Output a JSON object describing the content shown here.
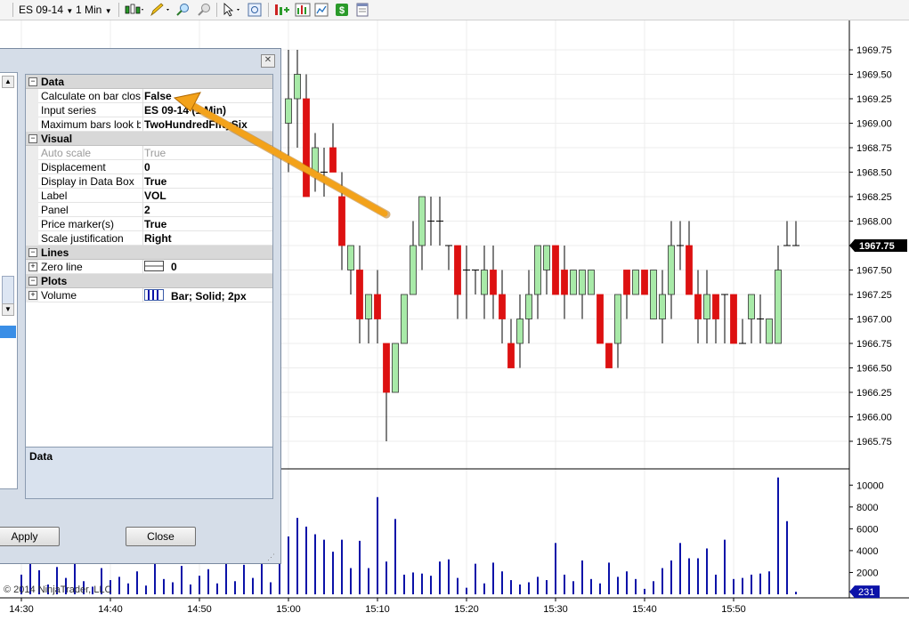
{
  "toolbar": {
    "instrument": "ES 09-14",
    "interval": "1 Min"
  },
  "dialog": {
    "categories": [
      {
        "name": "Data",
        "properties": [
          {
            "name": "Calculate on bar close",
            "value": "False"
          },
          {
            "name": "Input series",
            "value": "ES 09-14 (1 Min)"
          },
          {
            "name": "Maximum bars look back",
            "value": "TwoHundredFiftySix"
          }
        ]
      },
      {
        "name": "Visual",
        "properties": [
          {
            "name": "Auto scale",
            "value": "True"
          },
          {
            "name": "Displacement",
            "value": "0"
          },
          {
            "name": "Display in Data Box",
            "value": "True"
          },
          {
            "name": "Label",
            "value": "VOL"
          },
          {
            "name": "Panel",
            "value": "2"
          },
          {
            "name": "Price marker(s)",
            "value": "True"
          },
          {
            "name": "Scale justification",
            "value": "Right"
          }
        ]
      },
      {
        "name": "Lines",
        "properties": [
          {
            "name": "Zero line",
            "value": "0"
          }
        ]
      },
      {
        "name": "Plots",
        "properties": [
          {
            "name": "Volume",
            "value": "Bar; Solid; 2px"
          }
        ]
      }
    ],
    "description_title": "Data",
    "apply_label": "Apply",
    "close_label": "Close"
  },
  "copyright": "© 2014 NinjaTrader, LLC",
  "chart_data": {
    "type": "candlestick",
    "instrument": "ES 09-14",
    "interval": "1 Min",
    "price_axis_ticks": [
      "1969.75",
      "1969.50",
      "1969.25",
      "1969.00",
      "1968.75",
      "1968.50",
      "1968.25",
      "1968.00",
      "1967.75",
      "1967.50",
      "1967.25",
      "1967.00",
      "1966.75",
      "1966.50",
      "1966.25",
      "1966.00",
      "1965.75"
    ],
    "price_ylim": [
      1965.5,
      1970.0
    ],
    "last_price": "1967.75",
    "time_ticks": [
      "14:30",
      "14:40",
      "14:50",
      "15:00",
      "15:10",
      "15:20",
      "15:30",
      "15:40",
      "15:50"
    ],
    "volume_axis_ticks": [
      "10000",
      "8000",
      "6000",
      "4000",
      "2000"
    ],
    "volume_ylim": [
      0,
      11000
    ],
    "last_volume": "231",
    "candles": [
      {
        "t": "15:00",
        "o": 1969.0,
        "h": 1969.75,
        "l": 1968.5,
        "c": 1969.25
      },
      {
        "t": "15:01",
        "o": 1969.25,
        "h": 1969.75,
        "l": 1968.75,
        "c": 1969.5
      },
      {
        "t": "15:02",
        "o": 1969.25,
        "h": 1969.5,
        "l": 1968.25,
        "c": 1968.25
      },
      {
        "t": "15:03",
        "o": 1968.5,
        "h": 1968.9,
        "l": 1968.3,
        "c": 1968.75
      },
      {
        "t": "15:04",
        "o": 1968.5,
        "h": 1968.75,
        "l": 1968.25,
        "c": 1968.5
      },
      {
        "t": "15:05",
        "o": 1968.75,
        "h": 1969.0,
        "l": 1968.5,
        "c": 1968.5
      },
      {
        "t": "15:06",
        "o": 1968.25,
        "h": 1968.5,
        "l": 1967.5,
        "c": 1967.75
      },
      {
        "t": "15:07",
        "o": 1967.5,
        "h": 1967.75,
        "l": 1967.25,
        "c": 1967.75
      },
      {
        "t": "15:08",
        "o": 1967.5,
        "h": 1967.75,
        "l": 1966.75,
        "c": 1967.0
      },
      {
        "t": "15:09",
        "o": 1967.0,
        "h": 1967.25,
        "l": 1966.75,
        "c": 1967.25
      },
      {
        "t": "15:10",
        "o": 1967.25,
        "h": 1967.5,
        "l": 1966.75,
        "c": 1967.0
      },
      {
        "t": "15:11",
        "o": 1966.75,
        "h": 1966.75,
        "l": 1965.75,
        "c": 1966.25
      },
      {
        "t": "15:12",
        "o": 1966.25,
        "h": 1966.75,
        "l": 1966.25,
        "c": 1966.75
      },
      {
        "t": "15:13",
        "o": 1966.75,
        "h": 1967.25,
        "l": 1966.75,
        "c": 1967.25
      },
      {
        "t": "15:14",
        "o": 1967.25,
        "h": 1968.0,
        "l": 1967.25,
        "c": 1967.75
      },
      {
        "t": "15:15",
        "o": 1967.75,
        "h": 1968.25,
        "l": 1967.5,
        "c": 1968.25
      },
      {
        "t": "15:16",
        "o": 1968.0,
        "h": 1968.25,
        "l": 1967.75,
        "c": 1968.0
      },
      {
        "t": "15:17",
        "o": 1968.0,
        "h": 1968.25,
        "l": 1967.75,
        "c": 1968.0
      },
      {
        "t": "15:18",
        "o": 1967.75,
        "h": 1967.75,
        "l": 1967.5,
        "c": 1967.75
      },
      {
        "t": "15:19",
        "o": 1967.75,
        "h": 1967.75,
        "l": 1967.0,
        "c": 1967.25
      },
      {
        "t": "15:20",
        "o": 1967.5,
        "h": 1967.75,
        "l": 1967.0,
        "c": 1967.5
      },
      {
        "t": "15:21",
        "o": 1967.5,
        "h": 1967.5,
        "l": 1967.25,
        "c": 1967.5
      },
      {
        "t": "15:22",
        "o": 1967.25,
        "h": 1967.75,
        "l": 1967.0,
        "c": 1967.5
      },
      {
        "t": "15:23",
        "o": 1967.5,
        "h": 1967.75,
        "l": 1967.0,
        "c": 1967.25
      },
      {
        "t": "15:24",
        "o": 1967.25,
        "h": 1967.5,
        "l": 1966.75,
        "c": 1967.0
      },
      {
        "t": "15:25",
        "o": 1966.75,
        "h": 1967.0,
        "l": 1966.5,
        "c": 1966.5
      },
      {
        "t": "15:26",
        "o": 1966.75,
        "h": 1967.25,
        "l": 1966.5,
        "c": 1967.0
      },
      {
        "t": "15:27",
        "o": 1967.0,
        "h": 1967.5,
        "l": 1966.75,
        "c": 1967.25
      },
      {
        "t": "15:28",
        "o": 1967.25,
        "h": 1967.75,
        "l": 1967.0,
        "c": 1967.75
      },
      {
        "t": "15:29",
        "o": 1967.5,
        "h": 1967.75,
        "l": 1967.25,
        "c": 1967.75
      },
      {
        "t": "15:30",
        "o": 1967.75,
        "h": 1967.75,
        "l": 1967.25,
        "c": 1967.25
      },
      {
        "t": "15:31",
        "o": 1967.5,
        "h": 1967.75,
        "l": 1967.0,
        "c": 1967.25
      },
      {
        "t": "15:32",
        "o": 1967.25,
        "h": 1967.5,
        "l": 1967.25,
        "c": 1967.5
      },
      {
        "t": "15:33",
        "o": 1967.25,
        "h": 1967.5,
        "l": 1967.0,
        "c": 1967.5
      },
      {
        "t": "15:34",
        "o": 1967.25,
        "h": 1967.5,
        "l": 1967.25,
        "c": 1967.5
      },
      {
        "t": "15:35",
        "o": 1967.25,
        "h": 1967.25,
        "l": 1966.75,
        "c": 1966.75
      },
      {
        "t": "15:36",
        "o": 1966.75,
        "h": 1966.75,
        "l": 1966.5,
        "c": 1966.5
      },
      {
        "t": "15:37",
        "o": 1966.75,
        "h": 1967.25,
        "l": 1966.5,
        "c": 1967.25
      },
      {
        "t": "15:38",
        "o": 1967.5,
        "h": 1967.5,
        "l": 1967.0,
        "c": 1967.25
      },
      {
        "t": "15:39",
        "o": 1967.25,
        "h": 1967.5,
        "l": 1967.25,
        "c": 1967.5
      },
      {
        "t": "15:40",
        "o": 1967.5,
        "h": 1967.5,
        "l": 1967.25,
        "c": 1967.25
      },
      {
        "t": "15:41",
        "o": 1967.0,
        "h": 1967.5,
        "l": 1967.0,
        "c": 1967.5
      },
      {
        "t": "15:42",
        "o": 1967.0,
        "h": 1967.5,
        "l": 1966.75,
        "c": 1967.25
      },
      {
        "t": "15:43",
        "o": 1967.25,
        "h": 1968.0,
        "l": 1967.0,
        "c": 1967.75
      },
      {
        "t": "15:44",
        "o": 1967.75,
        "h": 1968.0,
        "l": 1967.5,
        "c": 1967.75
      },
      {
        "t": "15:45",
        "o": 1967.75,
        "h": 1968.0,
        "l": 1967.25,
        "c": 1967.25
      },
      {
        "t": "15:46",
        "o": 1967.25,
        "h": 1967.5,
        "l": 1966.75,
        "c": 1967.0
      },
      {
        "t": "15:47",
        "o": 1967.0,
        "h": 1967.5,
        "l": 1966.75,
        "c": 1967.25
      },
      {
        "t": "15:48",
        "o": 1967.25,
        "h": 1967.25,
        "l": 1966.75,
        "c": 1967.0
      },
      {
        "t": "15:49",
        "o": 1967.25,
        "h": 1967.25,
        "l": 1966.75,
        "c": 1967.25
      },
      {
        "t": "15:50",
        "o": 1967.25,
        "h": 1967.25,
        "l": 1966.75,
        "c": 1966.75
      },
      {
        "t": "15:51",
        "o": 1966.75,
        "h": 1967.0,
        "l": 1966.75,
        "c": 1966.75
      },
      {
        "t": "15:52",
        "o": 1967.0,
        "h": 1967.25,
        "l": 1966.75,
        "c": 1967.25
      },
      {
        "t": "15:53",
        "o": 1967.0,
        "h": 1967.25,
        "l": 1966.75,
        "c": 1967.0
      },
      {
        "t": "15:54",
        "o": 1966.75,
        "h": 1967.0,
        "l": 1966.75,
        "c": 1967.0
      },
      {
        "t": "15:55",
        "o": 1966.75,
        "h": 1967.75,
        "l": 1966.75,
        "c": 1967.5
      },
      {
        "t": "15:56",
        "o": 1967.75,
        "h": 1968.0,
        "l": 1967.75,
        "c": 1967.75
      },
      {
        "t": "15:57",
        "o": 1967.75,
        "h": 1968.0,
        "l": 1967.75,
        "c": 1967.75
      }
    ],
    "volume": [
      {
        "t": "14:30",
        "v": 1800
      },
      {
        "t": "14:31",
        "v": 3200
      },
      {
        "t": "14:32",
        "v": 2200
      },
      {
        "t": "14:33",
        "v": 900
      },
      {
        "t": "14:34",
        "v": 2500
      },
      {
        "t": "14:35",
        "v": 1500
      },
      {
        "t": "14:36",
        "v": 2800
      },
      {
        "t": "14:37",
        "v": 1200
      },
      {
        "t": "14:38",
        "v": 700
      },
      {
        "t": "14:39",
        "v": 2400
      },
      {
        "t": "14:40",
        "v": 1300
      },
      {
        "t": "14:41",
        "v": 1600
      },
      {
        "t": "14:42",
        "v": 1000
      },
      {
        "t": "14:43",
        "v": 2100
      },
      {
        "t": "14:44",
        "v": 800
      },
      {
        "t": "14:45",
        "v": 3600
      },
      {
        "t": "14:46",
        "v": 1400
      },
      {
        "t": "14:47",
        "v": 1100
      },
      {
        "t": "14:48",
        "v": 2600
      },
      {
        "t": "14:49",
        "v": 900
      },
      {
        "t": "14:50",
        "v": 1700
      },
      {
        "t": "14:51",
        "v": 2300
      },
      {
        "t": "14:52",
        "v": 1000
      },
      {
        "t": "14:53",
        "v": 3100
      },
      {
        "t": "14:54",
        "v": 1200
      },
      {
        "t": "14:55",
        "v": 2700
      },
      {
        "t": "14:56",
        "v": 1500
      },
      {
        "t": "14:57",
        "v": 3300
      },
      {
        "t": "14:58",
        "v": 1100
      },
      {
        "t": "14:59",
        "v": 4000
      },
      {
        "t": "15:00",
        "v": 5300
      },
      {
        "t": "15:01",
        "v": 7000
      },
      {
        "t": "15:02",
        "v": 6200
      },
      {
        "t": "15:03",
        "v": 5500
      },
      {
        "t": "15:04",
        "v": 5000
      },
      {
        "t": "15:05",
        "v": 3900
      },
      {
        "t": "15:06",
        "v": 5000
      },
      {
        "t": "15:07",
        "v": 2400
      },
      {
        "t": "15:08",
        "v": 4900
      },
      {
        "t": "15:09",
        "v": 2400
      },
      {
        "t": "15:10",
        "v": 8900
      },
      {
        "t": "15:11",
        "v": 3000
      },
      {
        "t": "15:12",
        "v": 6900
      },
      {
        "t": "15:13",
        "v": 1800
      },
      {
        "t": "15:14",
        "v": 2000
      },
      {
        "t": "15:15",
        "v": 1900
      },
      {
        "t": "15:16",
        "v": 1700
      },
      {
        "t": "15:17",
        "v": 3000
      },
      {
        "t": "15:18",
        "v": 3200
      },
      {
        "t": "15:19",
        "v": 1500
      },
      {
        "t": "15:20",
        "v": 600
      },
      {
        "t": "15:21",
        "v": 2800
      },
      {
        "t": "15:22",
        "v": 1000
      },
      {
        "t": "15:23",
        "v": 2900
      },
      {
        "t": "15:24",
        "v": 2100
      },
      {
        "t": "15:25",
        "v": 1300
      },
      {
        "t": "15:26",
        "v": 900
      },
      {
        "t": "15:27",
        "v": 1100
      },
      {
        "t": "15:28",
        "v": 1600
      },
      {
        "t": "15:29",
        "v": 1300
      },
      {
        "t": "15:30",
        "v": 4700
      },
      {
        "t": "15:31",
        "v": 1800
      },
      {
        "t": "15:32",
        "v": 1200
      },
      {
        "t": "15:33",
        "v": 3100
      },
      {
        "t": "15:34",
        "v": 1400
      },
      {
        "t": "15:35",
        "v": 1000
      },
      {
        "t": "15:36",
        "v": 2900
      },
      {
        "t": "15:37",
        "v": 1600
      },
      {
        "t": "15:38",
        "v": 2100
      },
      {
        "t": "15:39",
        "v": 1400
      },
      {
        "t": "15:40",
        "v": 500
      },
      {
        "t": "15:41",
        "v": 1200
      },
      {
        "t": "15:42",
        "v": 2400
      },
      {
        "t": "15:43",
        "v": 3100
      },
      {
        "t": "15:44",
        "v": 4700
      },
      {
        "t": "15:45",
        "v": 3300
      },
      {
        "t": "15:46",
        "v": 3300
      },
      {
        "t": "15:47",
        "v": 4200
      },
      {
        "t": "15:48",
        "v": 1800
      },
      {
        "t": "15:49",
        "v": 5000
      },
      {
        "t": "15:50",
        "v": 1400
      },
      {
        "t": "15:51",
        "v": 1500
      },
      {
        "t": "15:52",
        "v": 1800
      },
      {
        "t": "15:53",
        "v": 1900
      },
      {
        "t": "15:54",
        "v": 2100
      },
      {
        "t": "15:55",
        "v": 10700
      },
      {
        "t": "15:56",
        "v": 6700
      },
      {
        "t": "15:57",
        "v": 231
      }
    ],
    "up_color": "#a8eaa8",
    "down_color": "#dd1111",
    "volume_color": "#0b12a8"
  }
}
